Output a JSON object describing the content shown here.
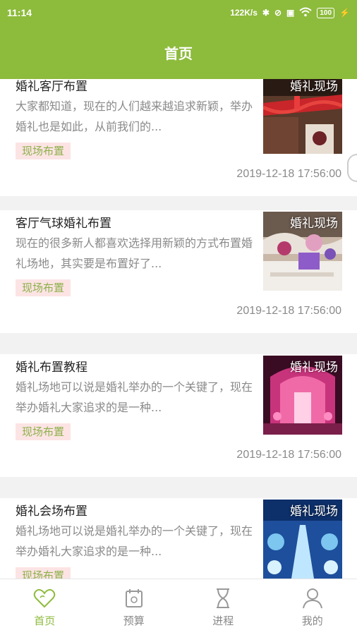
{
  "status_bar": {
    "time": "11:14",
    "net_speed": "122K/s",
    "battery": "100"
  },
  "header": {
    "title": "首页"
  },
  "articles": [
    {
      "title": "婚礼客厅布置",
      "desc": "大家都知道，现在的人们越来越追求新颖，举办婚礼也是如此，从前我们的...",
      "tag": "现场布置",
      "time": "2019-12-18 17:56:00",
      "thumb_label": "婚礼现场"
    },
    {
      "title": "客厅气球婚礼布置",
      "desc": "现在的很多新人都喜欢选择用新颖的方式布置婚礼场地，其实要是布置好了...",
      "tag": "现场布置",
      "time": "2019-12-18 17:56:00",
      "thumb_label": "婚礼现场"
    },
    {
      "title": "婚礼布置教程",
      "desc": "婚礼场地可以说是婚礼举办的一个关键了，现在举办婚礼大家追求的是一种...",
      "tag": "现场布置",
      "time": "2019-12-18 17:56:00",
      "thumb_label": "婚礼现场"
    },
    {
      "title": "婚礼会场布置",
      "desc": "婚礼场地可以说是婚礼举办的一个关键了，现在举办婚礼大家追求的是一种...",
      "tag": "现场布置",
      "time": "",
      "thumb_label": "婚礼现场"
    }
  ],
  "tabs": [
    {
      "label": "首页",
      "icon": "heart-icon",
      "active": true
    },
    {
      "label": "预算",
      "icon": "calendar-icon",
      "active": false
    },
    {
      "label": "进程",
      "icon": "hourglass-icon",
      "active": false
    },
    {
      "label": "我的",
      "icon": "person-icon",
      "active": false
    }
  ],
  "colors": {
    "brand_green": "#8dbb3c",
    "tag_bg": "#fce4e4",
    "tag_text": "#8db04a"
  }
}
